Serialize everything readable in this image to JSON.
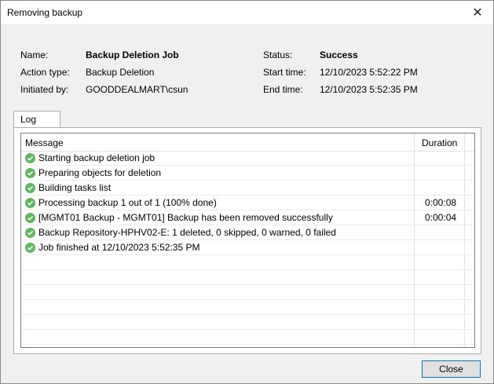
{
  "window": {
    "title": "Removing backup"
  },
  "info": {
    "name_label": "Name:",
    "name_value": "Backup Deletion Job",
    "action_label": "Action type:",
    "action_value": "Backup Deletion",
    "initiated_label": "Initiated by:",
    "initiated_value": "GOODDEALMART\\csun",
    "status_label": "Status:",
    "status_value": "Success",
    "start_label": "Start time:",
    "start_value": "12/10/2023 5:52:22 PM",
    "end_label": "End time:",
    "end_value": "12/10/2023 5:52:35 PM"
  },
  "tabs": [
    {
      "label": "Log"
    }
  ],
  "log": {
    "columns": {
      "message": "Message",
      "duration": "Duration"
    },
    "rows": [
      {
        "status": "success",
        "message": "Starting backup deletion job",
        "duration": ""
      },
      {
        "status": "success",
        "message": "Preparing objects for deletion",
        "duration": ""
      },
      {
        "status": "success",
        "message": "Building tasks list",
        "duration": ""
      },
      {
        "status": "success",
        "message": "Processing backup 1 out of 1 (100% done)",
        "duration": "0:00:08"
      },
      {
        "status": "success",
        "message": "[MGMT01 Backup - MGMT01] Backup has been removed successfully",
        "duration": "0:00:04"
      },
      {
        "status": "success",
        "message": "Backup Repository-HPHV02-E: 1 deleted, 0 skipped, 0 warned, 0 failed",
        "duration": ""
      },
      {
        "status": "success",
        "message": "Job finished at 12/10/2023 5:52:35 PM",
        "duration": ""
      }
    ],
    "empty_rows": 6,
    "success_color": "#5db95d"
  },
  "buttons": {
    "close": "Close"
  }
}
